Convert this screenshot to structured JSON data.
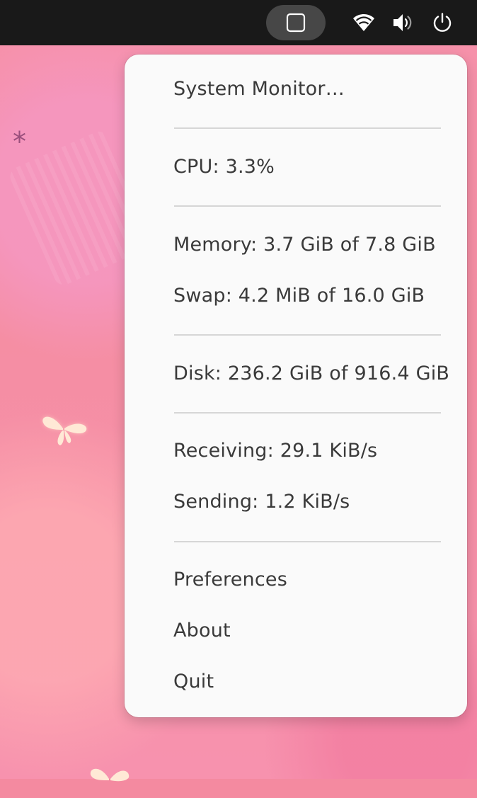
{
  "topbar": {
    "indicator": "system-monitor-indicator",
    "icons": [
      "wifi-icon",
      "volume-icon",
      "power-icon"
    ]
  },
  "menu": {
    "system_monitor": "System Monitor…",
    "cpu": "CPU: 3.3%",
    "memory": "Memory: 3.7 GiB of 7.8 GiB",
    "swap": "Swap: 4.2 MiB of 16.0 GiB",
    "disk": "Disk: 236.2 GiB of 916.4 GiB",
    "receiving": "Receiving: 29.1 KiB/s",
    "sending": "Sending: 1.2 KiB/s",
    "preferences": "Preferences",
    "about": "About",
    "quit": "Quit"
  },
  "colors": {
    "topbar": "#191919",
    "menu_bg": "#fafafa",
    "menu_text": "#3a3a3a",
    "wallpaper": "#f58ea3"
  }
}
